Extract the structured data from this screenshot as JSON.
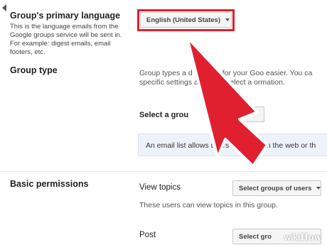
{
  "language_section": {
    "title": "Group's primary language",
    "description": "This is the language emails from the Google groups service will be sent in. For example: digest emails, email footers, etc.",
    "select_value": "English (United States)"
  },
  "group_type_section": {
    "title": "Group type",
    "description": "Group types a      d settings for your Goo easier. You ca      specific settings a needs. Select a      ormation.",
    "select_label": "Select a grou",
    "select_value": "t",
    "info_text": "An email list allows users to post from the web or th"
  },
  "permissions_section": {
    "title": "Basic permissions",
    "view_topics_label": "View topics",
    "view_topics_select": "Select groups of users",
    "view_topics_help": "These users can view topics in this group.",
    "post_label": "Post",
    "post_select": "Select gro"
  },
  "watermark": {
    "wiki": "wiki",
    "how": "How"
  },
  "annotation": {
    "highlight_color": "#e0202e",
    "arrow_color": "#e0202e",
    "arrow_icon": "red-pointer-arrow"
  }
}
